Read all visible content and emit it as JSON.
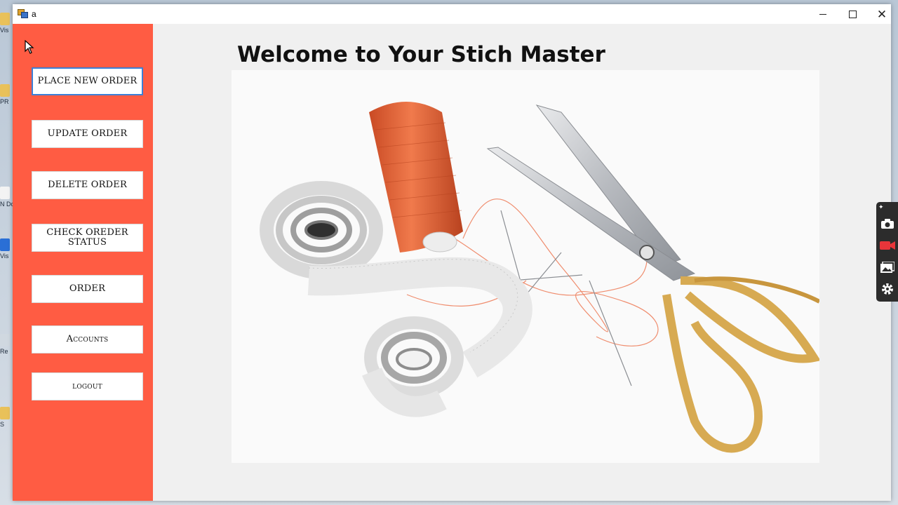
{
  "window": {
    "title": "a"
  },
  "main": {
    "title": "Welcome to Your Stich Master"
  },
  "sidebar": {
    "buttons": [
      {
        "label": "PLACE NEW ORDER"
      },
      {
        "label": "UPDATE ORDER"
      },
      {
        "label": "DELETE ORDER"
      },
      {
        "label": "CHECK OREDER STATUS"
      },
      {
        "label": "ORDER"
      },
      {
        "label": "Accounts"
      },
      {
        "label": "logout"
      }
    ]
  },
  "desktop": {
    "icons": [
      {
        "label": "Vis"
      },
      {
        "label": "PR"
      },
      {
        "label": "N Do"
      },
      {
        "label": "Vis"
      },
      {
        "label": "Re"
      },
      {
        "label": "S"
      }
    ]
  },
  "colors": {
    "sidebar": "#ff5c43",
    "thread": "#e8633a",
    "scissors_gold": "#d7aa52"
  },
  "icons": {
    "tools": [
      "pin-icon",
      "camera-icon",
      "video-icon",
      "gallery-icon",
      "settings-icon"
    ]
  }
}
